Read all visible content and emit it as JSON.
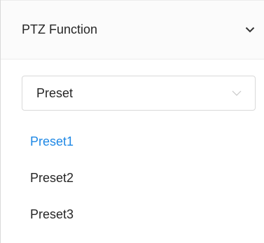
{
  "panel": {
    "title": "PTZ Function",
    "icons": {
      "collapse": "chevron-down-icon"
    }
  },
  "select": {
    "value": "Preset",
    "icon": "chevron-down-icon"
  },
  "presets": [
    {
      "label": "Preset1",
      "active": true
    },
    {
      "label": "Preset2",
      "active": false
    },
    {
      "label": "Preset3",
      "active": false
    }
  ],
  "colors": {
    "active": "#1e88e5",
    "text": "#262626",
    "border": "#d9d9d9"
  }
}
